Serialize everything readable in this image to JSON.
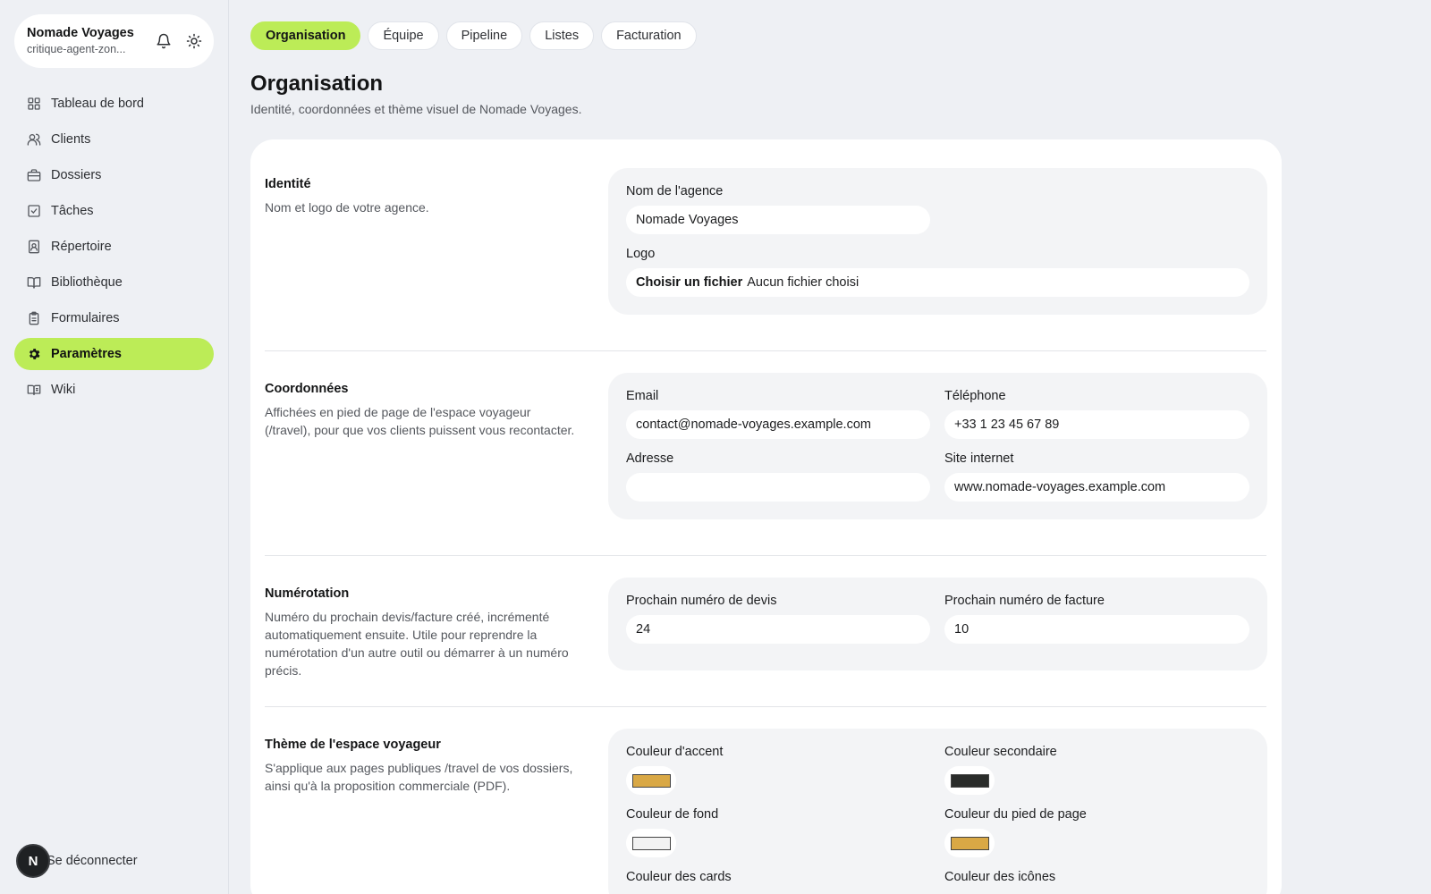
{
  "brand": {
    "name": "Nomade Voyages",
    "subtitle": "critique-agent-zon..."
  },
  "nav": [
    {
      "label": "Tableau de bord",
      "icon": "dashboard-icon"
    },
    {
      "label": "Clients",
      "icon": "users-icon"
    },
    {
      "label": "Dossiers",
      "icon": "briefcase-icon"
    },
    {
      "label": "Tâches",
      "icon": "checkbox-icon"
    },
    {
      "label": "Répertoire",
      "icon": "contact-book-icon"
    },
    {
      "label": "Bibliothèque",
      "icon": "book-icon"
    },
    {
      "label": "Formulaires",
      "icon": "clipboard-icon"
    },
    {
      "label": "Paramètres",
      "icon": "gear-icon",
      "active": true
    },
    {
      "label": "Wiki",
      "icon": "open-book-icon"
    }
  ],
  "logout": {
    "avatar": "N",
    "label": "Se déconnecter"
  },
  "tabs": [
    {
      "label": "Organisation",
      "active": true
    },
    {
      "label": "Équipe"
    },
    {
      "label": "Pipeline"
    },
    {
      "label": "Listes"
    },
    {
      "label": "Facturation"
    }
  ],
  "page": {
    "title": "Organisation",
    "subtitle": "Identité, coordonnées et thème visuel de Nomade Voyages."
  },
  "identity": {
    "title": "Identité",
    "description": "Nom et logo de votre agence.",
    "name_label": "Nom de l'agence",
    "name_value": "Nomade Voyages",
    "logo_label": "Logo",
    "file_button": "Choisir un fichier",
    "file_status": "Aucun fichier choisi"
  },
  "contact": {
    "title": "Coordonnées",
    "description": "Affichées en pied de page de l'espace voyageur (/travel), pour que vos clients puissent vous recontacter.",
    "email_label": "Email",
    "email_value": "contact@nomade-voyages.example.com",
    "phone_label": "Téléphone",
    "phone_value": "+33 1 23 45 67 89",
    "address_label": "Adresse",
    "address_value": "",
    "website_label": "Site internet",
    "website_value": "www.nomade-voyages.example.com"
  },
  "numbering": {
    "title": "Numérotation",
    "description": "Numéro du prochain devis/facture créé, incrémenté automatiquement ensuite. Utile pour reprendre la numérotation d'un autre outil ou démarrer à un numéro précis.",
    "quote_label": "Prochain numéro de devis",
    "quote_value": "24",
    "invoice_label": "Prochain numéro de facture",
    "invoice_value": "10"
  },
  "theme": {
    "title": "Thème de l'espace voyageur",
    "description": "S'applique aux pages publiques /travel de vos dossiers, ainsi qu'à la proposition commerciale (PDF).",
    "accent_label": "Couleur d'accent",
    "accent_color": "#d9a845",
    "secondary_label": "Couleur secondaire",
    "secondary_color": "#2a2c2a",
    "background_label": "Couleur de fond",
    "background_color": "#f2f2f2",
    "footer_label": "Couleur du pied de page",
    "footer_color": "#d9a845",
    "cards_label": "Couleur des cards",
    "icons_label": "Couleur des icônes"
  },
  "colors": {
    "accent_green": "#bcec57"
  }
}
